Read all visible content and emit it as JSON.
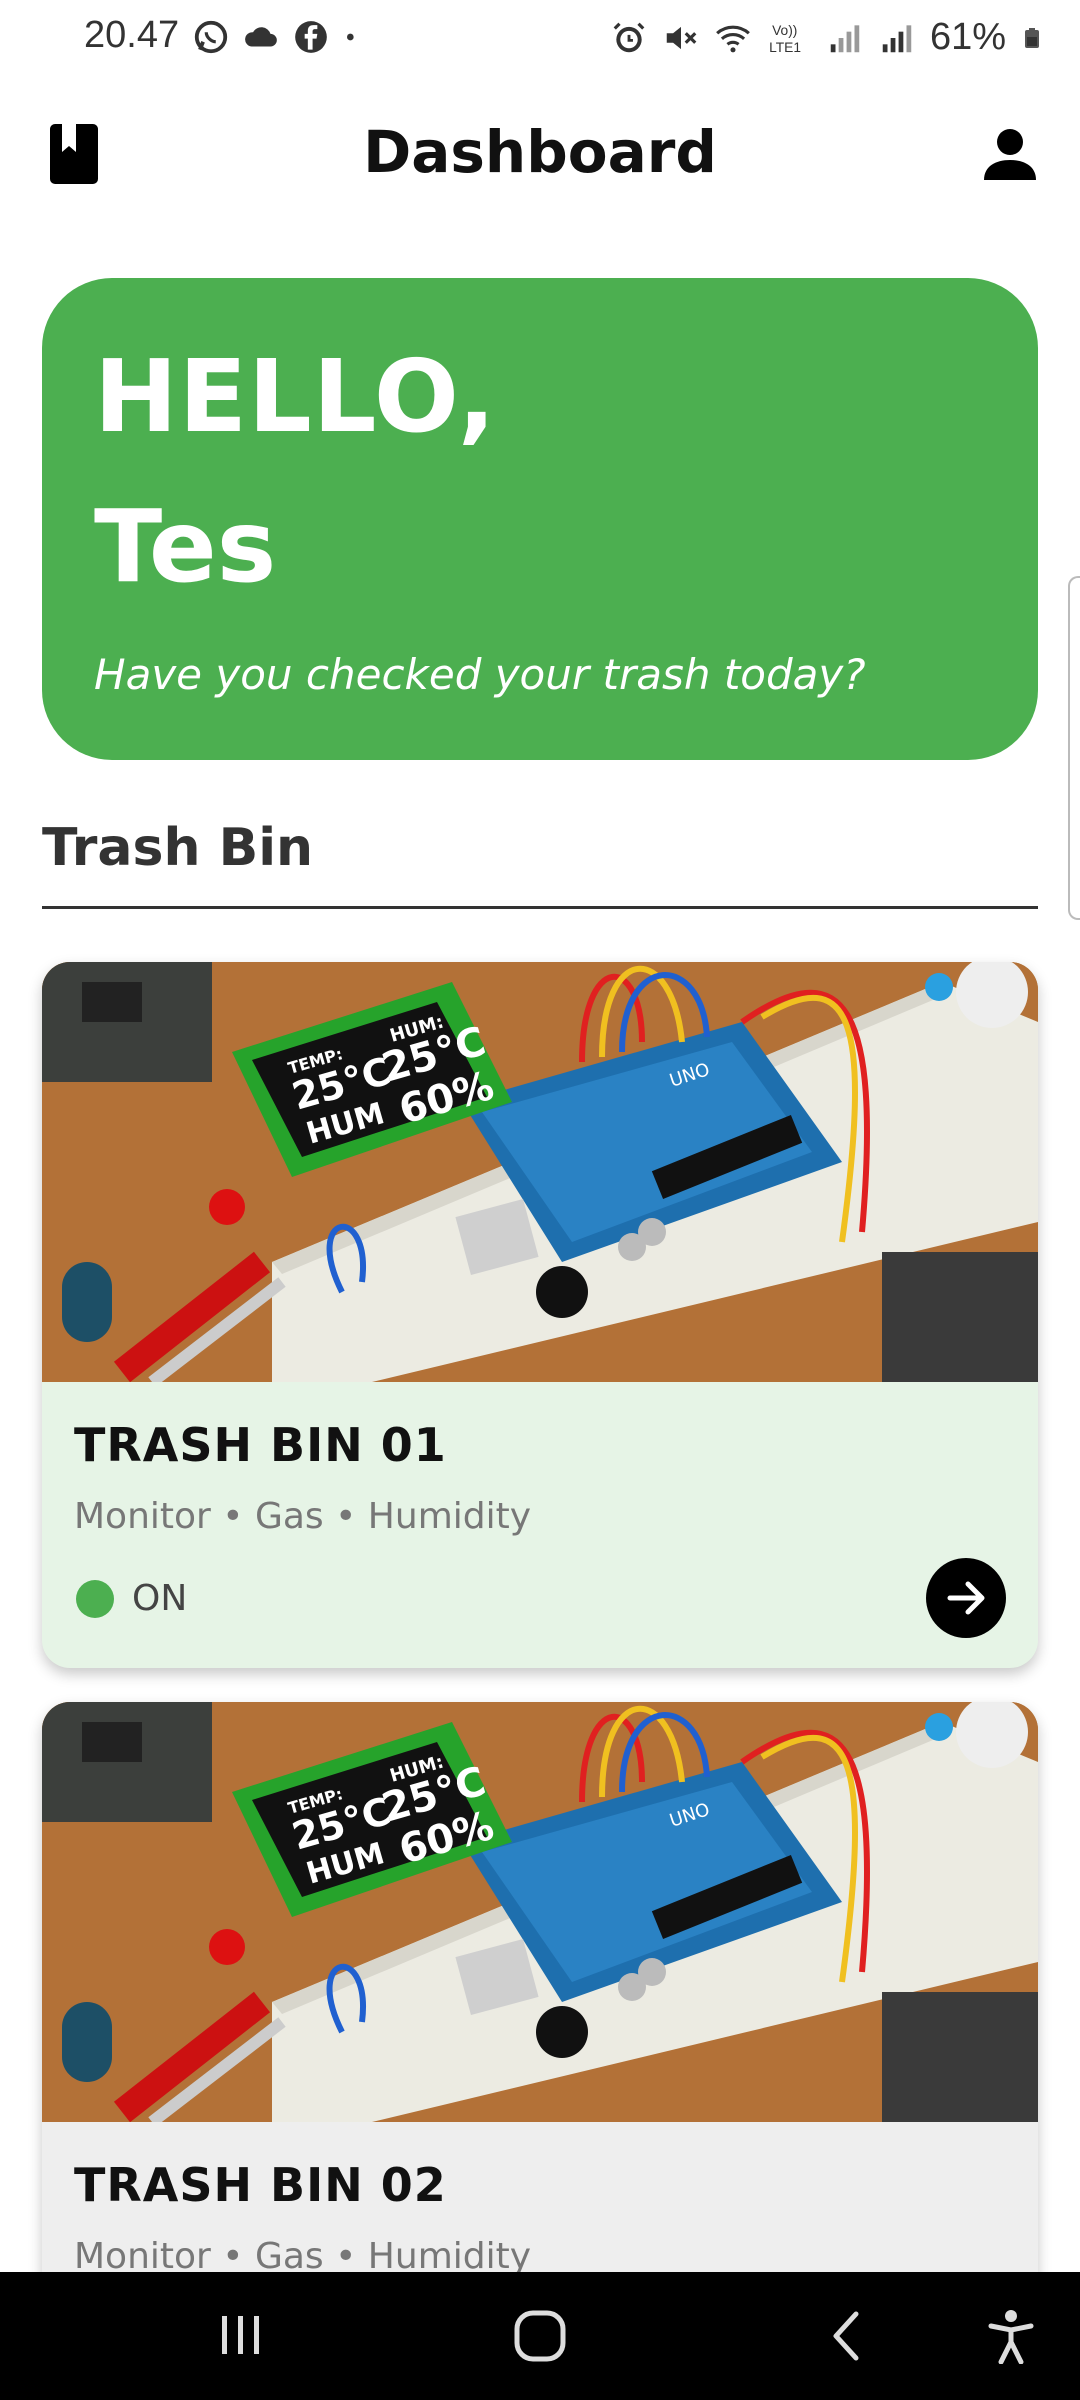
{
  "status_bar": {
    "time": "20.47",
    "battery": "61%",
    "left_icons": [
      "whatsapp-icon",
      "cloud-icon",
      "facebook-icon",
      "dot-icon"
    ],
    "right_icons": [
      "alarm-icon",
      "mute-icon",
      "wifi-icon",
      "volte-icon",
      "signal-icon",
      "signal-icon",
      "battery-icon"
    ]
  },
  "app_bar": {
    "title": "Dashboard",
    "left_icon": "book-icon",
    "right_icon": "person-icon"
  },
  "greeting": {
    "hello": "HELLO,",
    "name": "Tes",
    "subtitle": "Have you checked your trash today?",
    "color": "#4caf50"
  },
  "section": {
    "title": "Trash Bin"
  },
  "bins": [
    {
      "title": "TRASH BIN 01",
      "subtitle": "Monitor • Gas • Humidity",
      "status": "ON",
      "status_color": "#4caf50",
      "card_color": "#e6f4e6"
    },
    {
      "title": "TRASH BIN 02",
      "subtitle": "Monitor • Gas • Humidity",
      "card_color": "#eeeeee"
    }
  ],
  "image_panel": {
    "temp_label": "TEMP:",
    "temp_value": "25°C",
    "hum_label": "HUM:",
    "hum_value": "25°C",
    "hum_percent": "60%",
    "hum_short": "HUM",
    "board_label": "UNO"
  },
  "nav_bar": {
    "icons": [
      "recent-apps-icon",
      "home-icon",
      "back-icon",
      "accessibility-icon"
    ]
  }
}
